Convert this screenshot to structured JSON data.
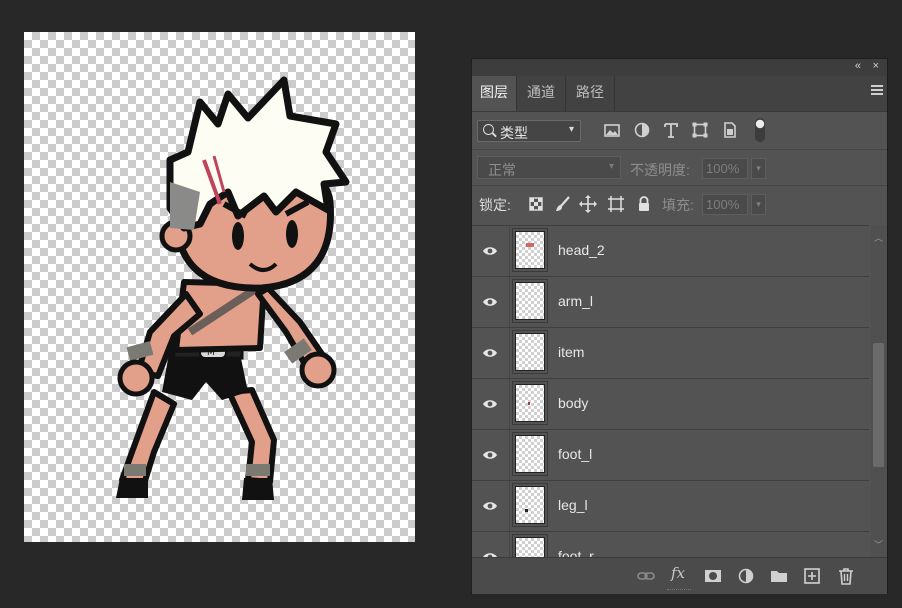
{
  "panel": {
    "titlebar": {
      "collapse_glyph": "«",
      "close_glyph": "×"
    },
    "tabs": [
      {
        "label": "图层",
        "active": true
      },
      {
        "label": "通道",
        "active": false
      },
      {
        "label": "路径",
        "active": false
      }
    ],
    "filter": {
      "kind_label": "类型",
      "icons": [
        "image-filter-icon",
        "adjustment-filter-icon",
        "type-filter-icon",
        "shape-filter-icon",
        "smart-object-filter-icon",
        "filter-toggle-icon"
      ]
    },
    "blend": {
      "mode": "正常",
      "opacity_label": "不透明度:",
      "opacity_value": "100%"
    },
    "lock": {
      "label": "锁定:",
      "icons": [
        "lock-transparent-pixels-icon",
        "lock-image-pixels-icon",
        "lock-position-icon",
        "lock-artboard-icon",
        "lock-all-icon"
      ],
      "fill_label": "填充:",
      "fill_value": "100%"
    },
    "layers": [
      {
        "name": "head_2",
        "visible": true
      },
      {
        "name": "arm_l",
        "visible": true
      },
      {
        "name": "item",
        "visible": true
      },
      {
        "name": "body",
        "visible": true
      },
      {
        "name": "foot_l",
        "visible": true
      },
      {
        "name": "leg_l",
        "visible": true
      },
      {
        "name": "foot_r",
        "visible": true
      }
    ],
    "bottom_icons": [
      "link-layers-icon",
      "fx-icon",
      "add-mask-icon",
      "adjustment-layer-icon",
      "new-group-icon",
      "new-layer-icon",
      "delete-layer-icon"
    ],
    "fx_label": "fx"
  },
  "colors": {
    "panel_bg": "#535353",
    "app_bg": "#282828",
    "skin": "#e2a08a",
    "hair": "#ffffff",
    "scar": "#c0445a"
  }
}
